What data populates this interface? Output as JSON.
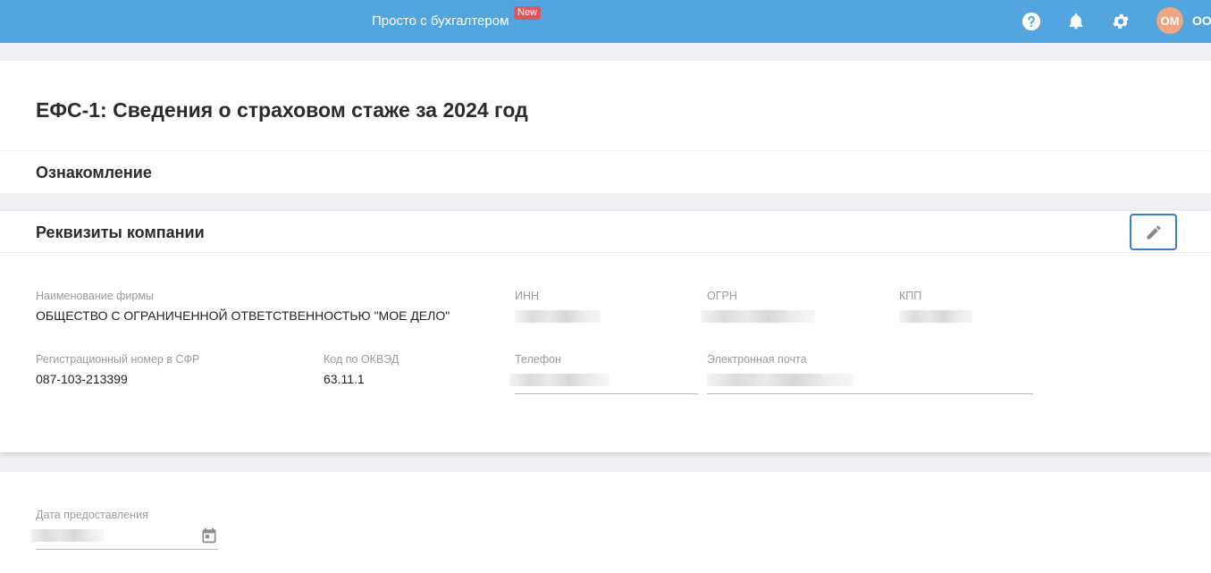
{
  "header": {
    "promo_link": "Просто с бухгалтером",
    "new_badge": "New",
    "avatar_initials": "ОМ",
    "user_name_truncated": "ОО"
  },
  "page": {
    "title": "ЕФС-1: Сведения о страховом стаже за 2024 год",
    "intro_section": "Ознакомление",
    "company_section": "Реквизиты компании"
  },
  "company": {
    "name_label": "Наименование фирмы",
    "name_value": "ОБЩЕСТВО С ОГРАНИЧЕННОЙ ОТВЕТСТВЕННОСТЬЮ \"МОЕ ДЕЛО\"",
    "inn_label": "ИНН",
    "ogrn_label": "ОГРН",
    "kpp_label": "КПП",
    "sfr_label": "Регистрационный номер в СФР",
    "sfr_value": "087-103-213399",
    "okved_label": "Код по ОКВЭД",
    "okved_value": "63.11.1",
    "phone_label": "Телефон",
    "email_label": "Электронная почта"
  },
  "submission": {
    "date_label": "Дата предоставления"
  },
  "icons": [
    "help-icon",
    "bell-icon",
    "gear-icon",
    "pencil-icon",
    "calendar-icon"
  ],
  "colors": {
    "topbar": "#53a5de",
    "badge": "#e0545a",
    "avatar": "#f0a583",
    "edit_border": "#3d7ec4"
  }
}
